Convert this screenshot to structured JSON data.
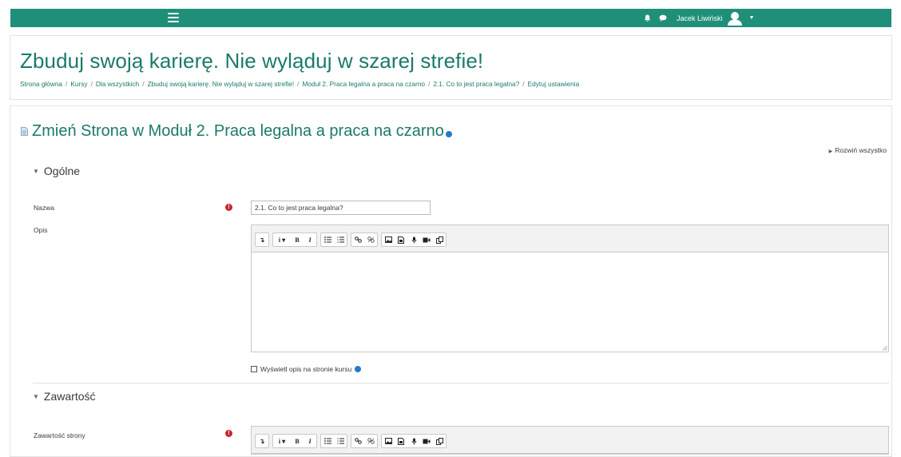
{
  "topbar": {
    "user_name": "Jacek Liwiński",
    "brand_color": "#1f8f7a"
  },
  "header": {
    "course_title": "Zbuduj swoją karierę. Nie wyląduj w szarej strefie!",
    "breadcrumb": [
      "Strona główna",
      "Kursy",
      "Dla wszystkich",
      "Zbuduj swoją karierę. Nie wylą​duj w szarej strefie!",
      "Moduł 2. Praca legalna a praca na czarno",
      "2.1. Co to jest praca legalna?",
      "Edytuj ustawienia"
    ],
    "separator": "/"
  },
  "main": {
    "edit_title": "Zmień Strona w Moduł 2. Praca legalna a praca na czarno",
    "expand_all": "Rozwiń wszystko",
    "sections": {
      "general": "Ogólne",
      "content": "Zawartość"
    },
    "fields": {
      "name_label": "Nazwa",
      "name_value": "2.1. Co to jest praca legalna?",
      "description_label": "Opis",
      "show_description_label": "Wyświetl opis na stronie kursu",
      "page_content_label": "Zawartość strony"
    },
    "toolbar_buttons": {
      "collapse": "↴",
      "info": "i ▾",
      "bold": "B",
      "italic": "I"
    }
  },
  "colors": {
    "accent": "#1b7a69",
    "required": "#c8252c",
    "help": "#2a78c6"
  }
}
